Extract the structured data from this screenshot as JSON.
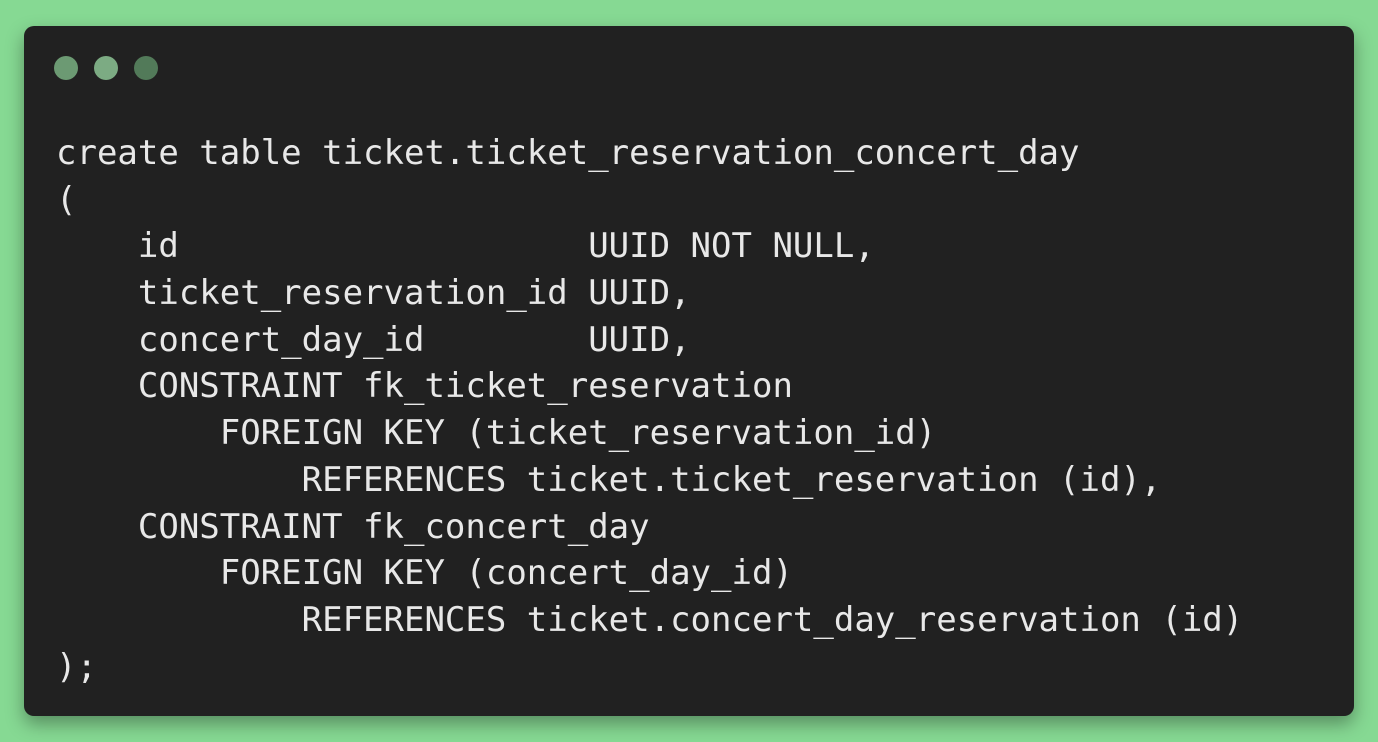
{
  "window": {
    "controls": [
      {
        "name": "close-dot",
        "color": "#6c9a73"
      },
      {
        "name": "minimize-dot",
        "color": "#7cab83"
      },
      {
        "name": "zoom-dot",
        "color": "#527a59"
      }
    ]
  },
  "code": {
    "lines": [
      "create table ticket.ticket_reservation_concert_day",
      "(",
      "    id                    UUID NOT NULL,",
      "    ticket_reservation_id UUID,",
      "    concert_day_id        UUID,",
      "    CONSTRAINT fk_ticket_reservation",
      "        FOREIGN KEY (ticket_reservation_id)",
      "            REFERENCES ticket.ticket_reservation (id),",
      "    CONSTRAINT fk_concert_day",
      "        FOREIGN KEY (concert_day_id)",
      "            REFERENCES ticket.concert_day_reservation (id)",
      ");"
    ]
  }
}
